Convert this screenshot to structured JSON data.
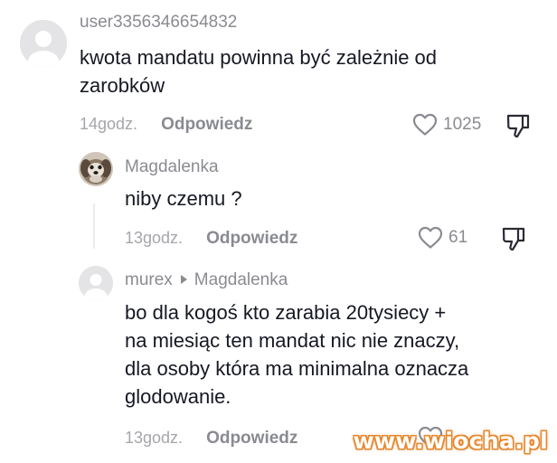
{
  "comments": [
    {
      "username": "user3356346654832",
      "text_lines": [
        "kwota mandatu powinna być zależnie od",
        "zarobków"
      ],
      "time": "14godz.",
      "reply_label": "Odpowiedz",
      "likes": "1025",
      "avatar_icon": "default-avatar-icon"
    },
    {
      "username": "Magdalenka",
      "text_lines": [
        "niby czemu ?"
      ],
      "time": "13godz.",
      "reply_label": "Odpowiedz",
      "likes": "61",
      "avatar_icon": "dog-photo-avatar"
    },
    {
      "username": "murex",
      "reply_to": "Magdalenka",
      "text_lines": [
        "bo dla kogoś kto zarabia 20tysiecy +",
        "na miesiąc ten mandat nic nie znaczy,",
        "dla osoby która ma minimalna oznacza",
        "glodowanie."
      ],
      "time": "13godz.",
      "reply_label": "Odpowiedz",
      "avatar_icon": "default-avatar-icon"
    }
  ],
  "watermark": "www.wiocha.pl",
  "icons": [
    "heart-icon",
    "dislike-icon",
    "reply-arrow-icon"
  ],
  "colors": {
    "text": "#161823",
    "muted": "#8a8b91",
    "time": "#a5a6ab",
    "watermark_outline": "#e8872a"
  }
}
